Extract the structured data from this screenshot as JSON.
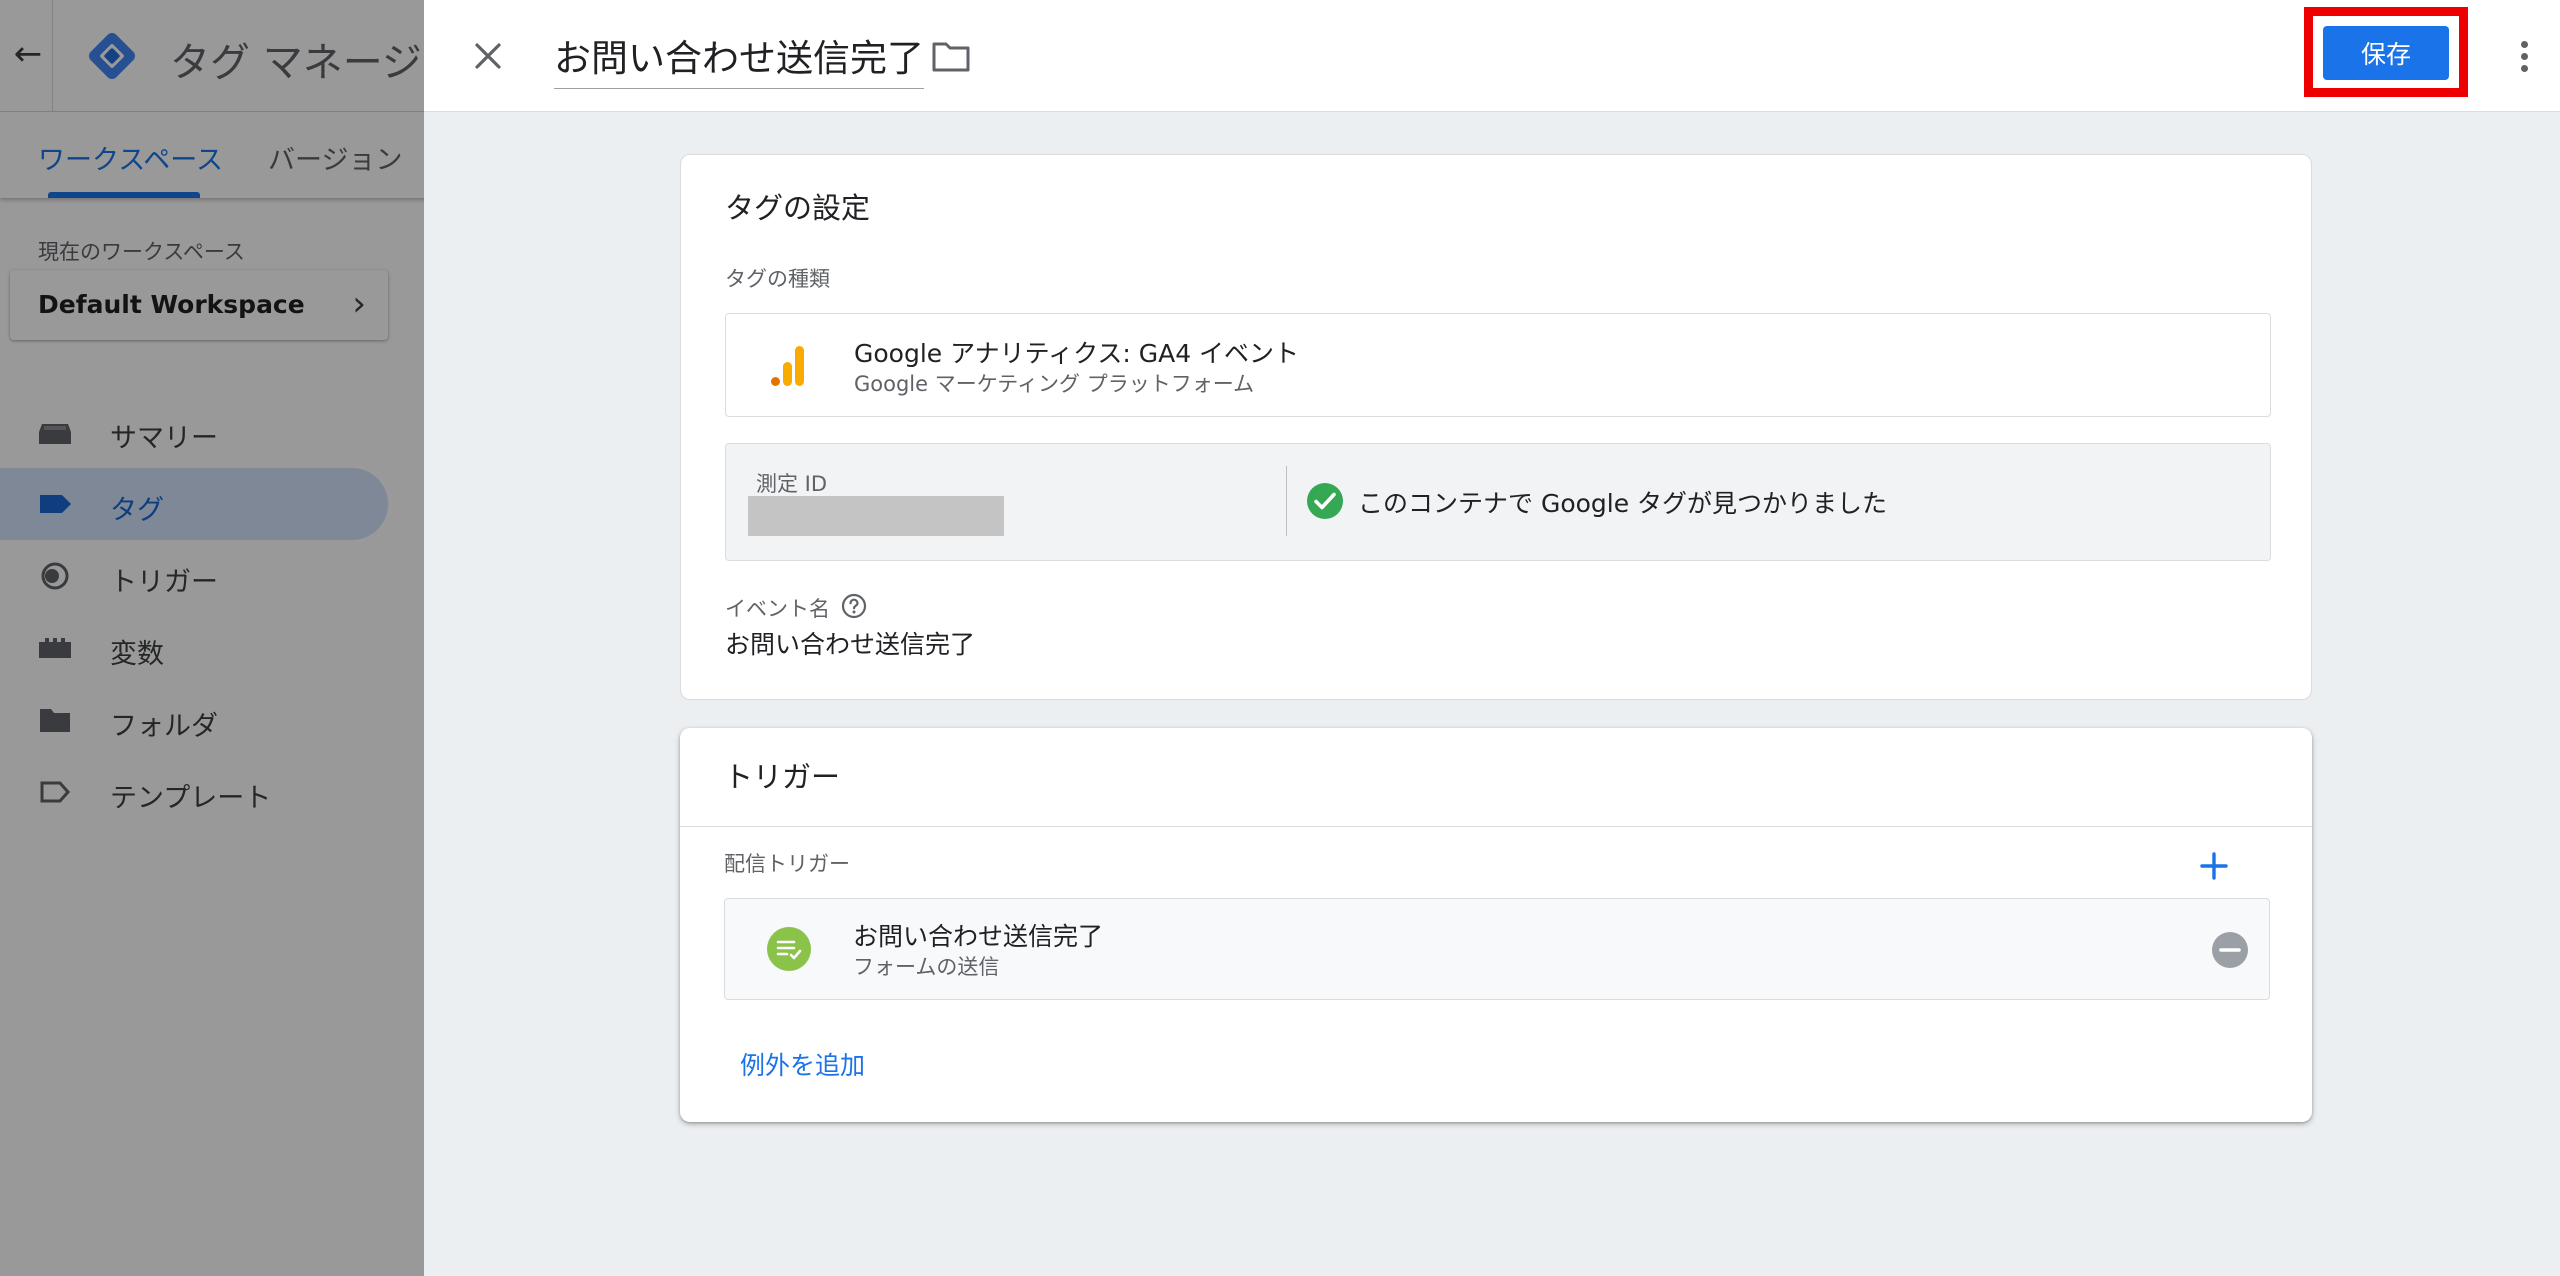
{
  "app": {
    "title": "タグ マネージャー",
    "tabs": [
      "ワークスペース",
      "バージョン"
    ],
    "workspace_label": "現在のワークスペース",
    "workspace_name": "Default Workspace",
    "nav": [
      {
        "label": "サマリー",
        "icon": "summary-icon"
      },
      {
        "label": "タグ",
        "icon": "tag-icon",
        "active": true
      },
      {
        "label": "トリガー",
        "icon": "trigger-icon"
      },
      {
        "label": "変数",
        "icon": "variables-icon"
      },
      {
        "label": "フォルダ",
        "icon": "folder-icon"
      },
      {
        "label": "テンプレート",
        "icon": "template-icon"
      }
    ]
  },
  "sheet": {
    "title": "お問い合わせ送信完了",
    "save_label": "保存",
    "config": {
      "heading": "タグの設定",
      "type_label": "タグの種類",
      "type_name": "Google アナリティクス: GA4 イベント",
      "type_sub": "Google マーケティング プラットフォーム",
      "id_label": "測定 ID",
      "found_text": "このコンテナで Google タグが見つかりました",
      "event_label": "イベント名",
      "event_value": "お問い合わせ送信完了"
    },
    "triggering": {
      "heading": "トリガー",
      "firing_label": "配信トリガー",
      "trigger_name": "お問い合わせ送信完了",
      "trigger_type": "フォームの送信",
      "add_exception": "例外を追加"
    }
  },
  "colors": {
    "accent": "#1a73e8",
    "highlight": "#ee0000",
    "success": "#34a853",
    "trigger_icon": "#8bc34a"
  }
}
